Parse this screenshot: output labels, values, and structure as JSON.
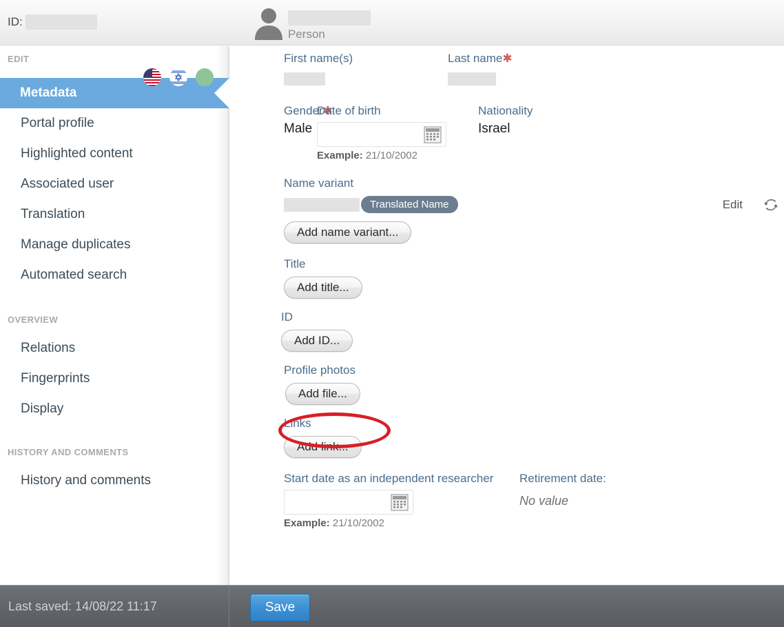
{
  "header": {
    "id_label": "ID:",
    "id_value_redacted": true,
    "person_label": "Person",
    "person_name_redacted": true,
    "avatar_icon": "person-silhouette-icon"
  },
  "sidebar": {
    "sections": [
      {
        "heading": "EDIT",
        "items": [
          {
            "label": "Metadata",
            "active": true
          },
          {
            "label": "Portal profile",
            "active": false
          },
          {
            "label": "Highlighted content",
            "active": false
          },
          {
            "label": "Associated user",
            "active": false
          },
          {
            "label": "Translation",
            "active": false
          },
          {
            "label": "Manage duplicates",
            "active": false
          },
          {
            "label": "Automated search",
            "active": false
          }
        ]
      },
      {
        "heading": "OVERVIEW",
        "items": [
          {
            "label": "Relations",
            "active": false
          },
          {
            "label": "Fingerprints",
            "active": false
          },
          {
            "label": "Display",
            "active": false
          }
        ]
      },
      {
        "heading": "HISTORY AND COMMENTS",
        "items": [
          {
            "label": "History and comments",
            "active": false
          }
        ]
      }
    ],
    "locale_icons": [
      {
        "name": "us-flag-icon",
        "title": "English (US)"
      },
      {
        "name": "israel-flag-icon",
        "title": "Hebrew (Israel)"
      },
      {
        "name": "green-status-circle-icon",
        "title": "Status"
      }
    ],
    "active_accent_color": "#6aaade"
  },
  "form": {
    "first_name": {
      "label": "First name(s)",
      "required": false,
      "value_redacted": true
    },
    "last_name": {
      "label": "Last name",
      "required": true,
      "required_mark": "✱",
      "value_redacted": true
    },
    "gender": {
      "label": "Gender",
      "required": true,
      "required_mark": "✱",
      "value": "Male"
    },
    "date_of_birth": {
      "label": "Date of birth",
      "value": "",
      "example": "Example: 21/10/2002",
      "example_prefix": "Example:",
      "example_value": "21/10/2002",
      "calendar_icon": "calendar-icon"
    },
    "nationality": {
      "label": "Nationality",
      "value": "Israel"
    },
    "name_variant": {
      "label": "Name variant",
      "value_redacted": true,
      "tag": "Translated Name",
      "edit_link": "Edit",
      "refresh_icon": "refresh-icon",
      "add_button": "Add name variant..."
    },
    "title": {
      "label": "Title",
      "add_button": "Add title..."
    },
    "id": {
      "label": "ID",
      "add_button": "Add ID..."
    },
    "profile_photos": {
      "label": "Profile photos",
      "add_button": "Add file...",
      "highlighted": true
    },
    "links": {
      "label": "Links",
      "add_button": "Add link..."
    },
    "start_date": {
      "label": "Start date as an independent researcher",
      "value": "",
      "example_prefix": "Example:",
      "example_value": "21/10/2002",
      "calendar_icon": "calendar-icon"
    },
    "retirement_date": {
      "label": "Retirement date:",
      "value": "No value"
    }
  },
  "annotation": {
    "shape": "ellipse",
    "color": "#d81f26",
    "targets": "add-file-button"
  },
  "footer": {
    "last_saved": "Last saved: 14/08/22 11:17",
    "save_label": "Save",
    "save_color": "#3d90d3"
  }
}
